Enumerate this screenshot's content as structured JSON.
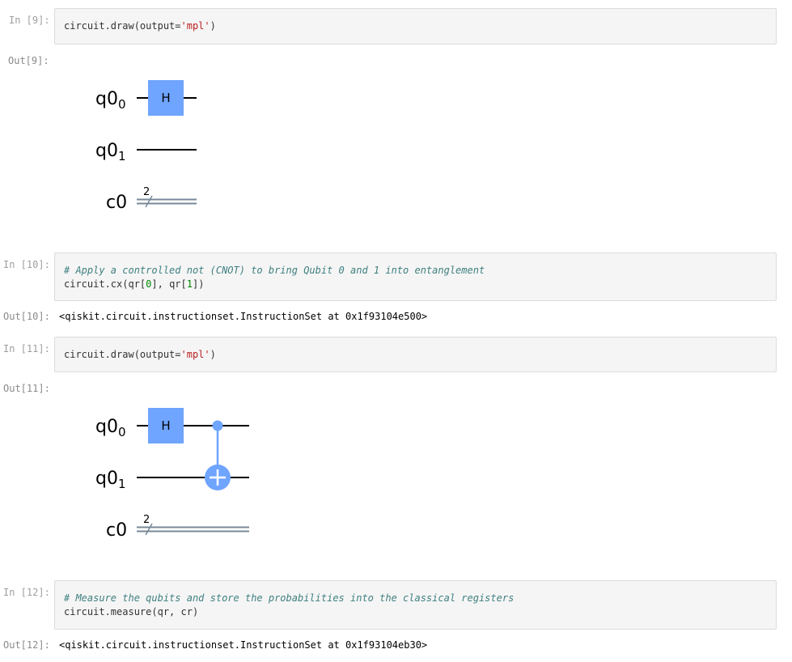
{
  "cells": {
    "c9": {
      "in_prompt": "In [9]:",
      "code": {
        "prefix": "circuit.draw(output=",
        "str": "'mpl'",
        "suffix": ")"
      },
      "out_prompt": "Out[9]:"
    },
    "c10": {
      "in_prompt": "In [10]:",
      "comment": "# Apply a controlled not (CNOT) to bring Qubit 0 and 1 into entanglement",
      "code": {
        "a": "circuit.cx(qr[",
        "n1": "0",
        "b": "], qr[",
        "n2": "1",
        "c": "])"
      },
      "out_prompt": "Out[10]:",
      "output": "<qiskit.circuit.instructionset.InstructionSet at 0x1f93104e500>"
    },
    "c11": {
      "in_prompt": "In [11]:",
      "code": {
        "prefix": "circuit.draw(output=",
        "str": "'mpl'",
        "suffix": ")"
      },
      "out_prompt": "Out[11]:"
    },
    "c12": {
      "in_prompt": "In [12]:",
      "comment": "# Measure the qubits and store the probabilities into the classical registers",
      "code": "circuit.measure(qr, cr)",
      "out_prompt": "Out[12]:",
      "output": "<qiskit.circuit.instructionset.InstructionSet at 0x1f93104eb30>"
    }
  },
  "circuit_labels": {
    "q_base": "q0",
    "q0_sub": "0",
    "q1_sub": "1",
    "c_reg": "c0",
    "c_width": "2",
    "h_gate": "H"
  },
  "colors": {
    "gate_blue": "#6fa4ff",
    "wire": "#000000",
    "classical_wire": "#778899",
    "input_bg": "#f5f5f5",
    "prompt": "#9e9e9e",
    "string": "#ba2121",
    "number": "#008800",
    "comment": "#408080"
  }
}
